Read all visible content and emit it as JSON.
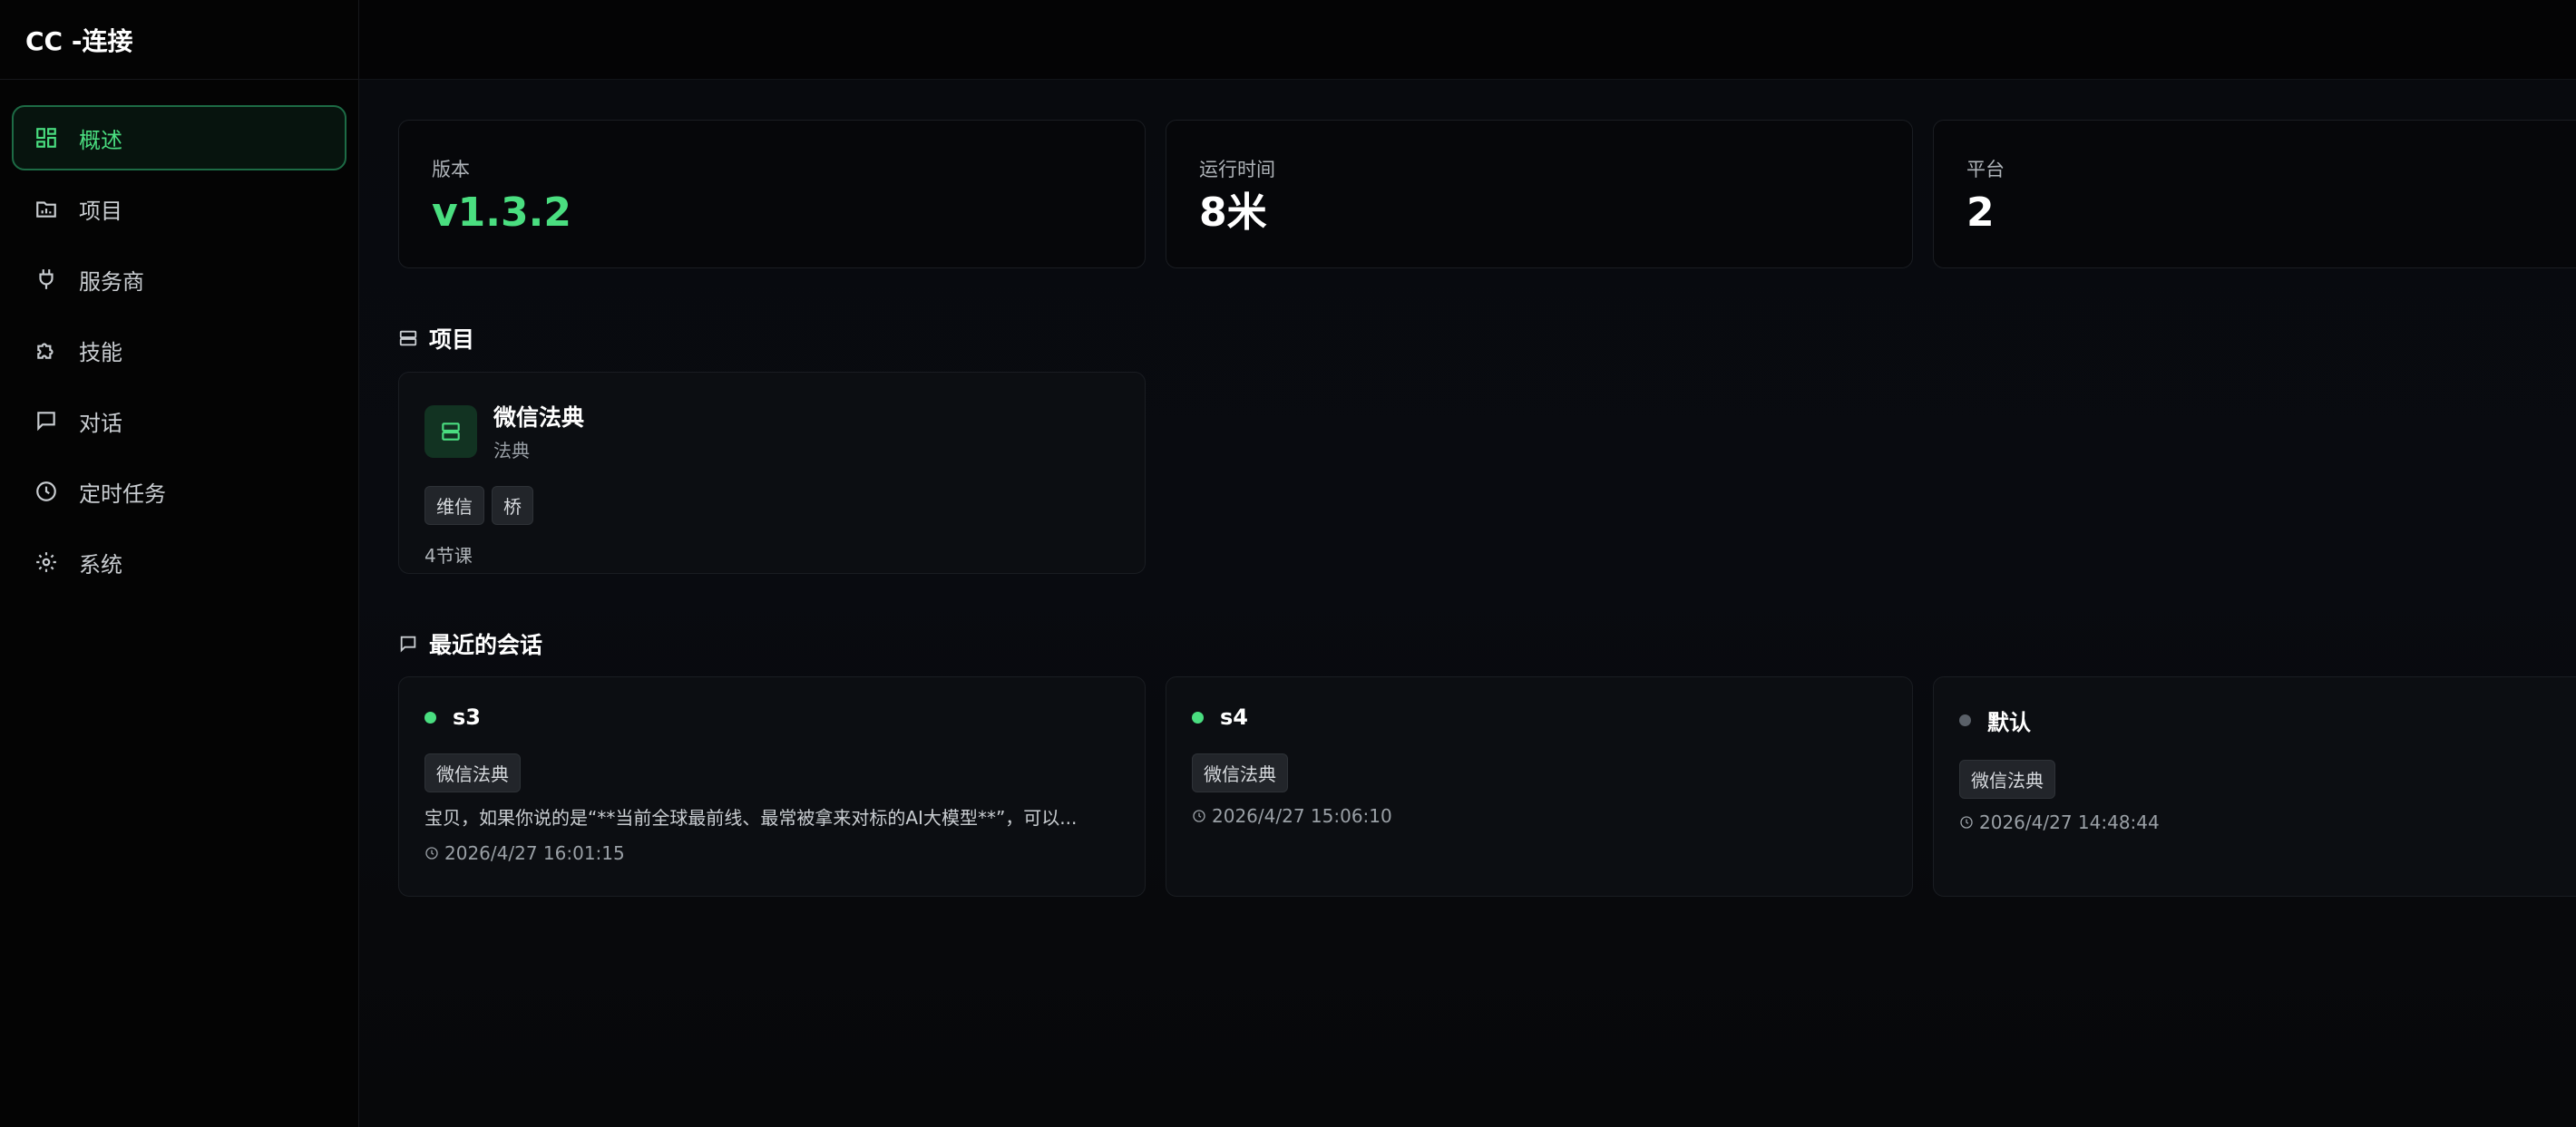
{
  "app": {
    "title": "CC -连接"
  },
  "sidebar": {
    "items": [
      {
        "label": "概述",
        "icon": "dashboard-icon",
        "active": true
      },
      {
        "label": "项目",
        "icon": "folder-icon"
      },
      {
        "label": "服务商",
        "icon": "plug-icon"
      },
      {
        "label": "技能",
        "icon": "puzzle-icon"
      },
      {
        "label": "对话",
        "icon": "message-icon"
      },
      {
        "label": "定时任务",
        "icon": "clock-icon"
      },
      {
        "label": "系统",
        "icon": "gear-icon"
      }
    ]
  },
  "stats": [
    {
      "label": "版本",
      "value": "v1.3.2"
    },
    {
      "label": "运行时间",
      "value": "8米"
    },
    {
      "label": "平台",
      "value": "2"
    }
  ],
  "projects": {
    "title": "项目",
    "items": [
      {
        "name": "微信法典",
        "subtitle": "法典",
        "tags": [
          "维信",
          "桥"
        ],
        "lessons": "4节课"
      }
    ]
  },
  "conversations": {
    "title": "最近的会话",
    "items": [
      {
        "name": "s3",
        "status": "active",
        "tag": "微信法典",
        "preview": "宝贝，如果你说的是“**当前全球最前线、最常被拿来对标的AI大模型**”，可以...",
        "time": "2026/4/27 16:01:15"
      },
      {
        "name": "s4",
        "status": "active",
        "tag": "微信法典",
        "preview": "",
        "time": "2026/4/27 15:06:10"
      },
      {
        "name": "默认",
        "status": "inactive",
        "tag": "微信法典",
        "preview": "",
        "time": "2026/4/27 14:48:44"
      }
    ]
  },
  "colors": {
    "accent": "#4ade80",
    "background": "#07080a",
    "card": "#0c0e12"
  }
}
